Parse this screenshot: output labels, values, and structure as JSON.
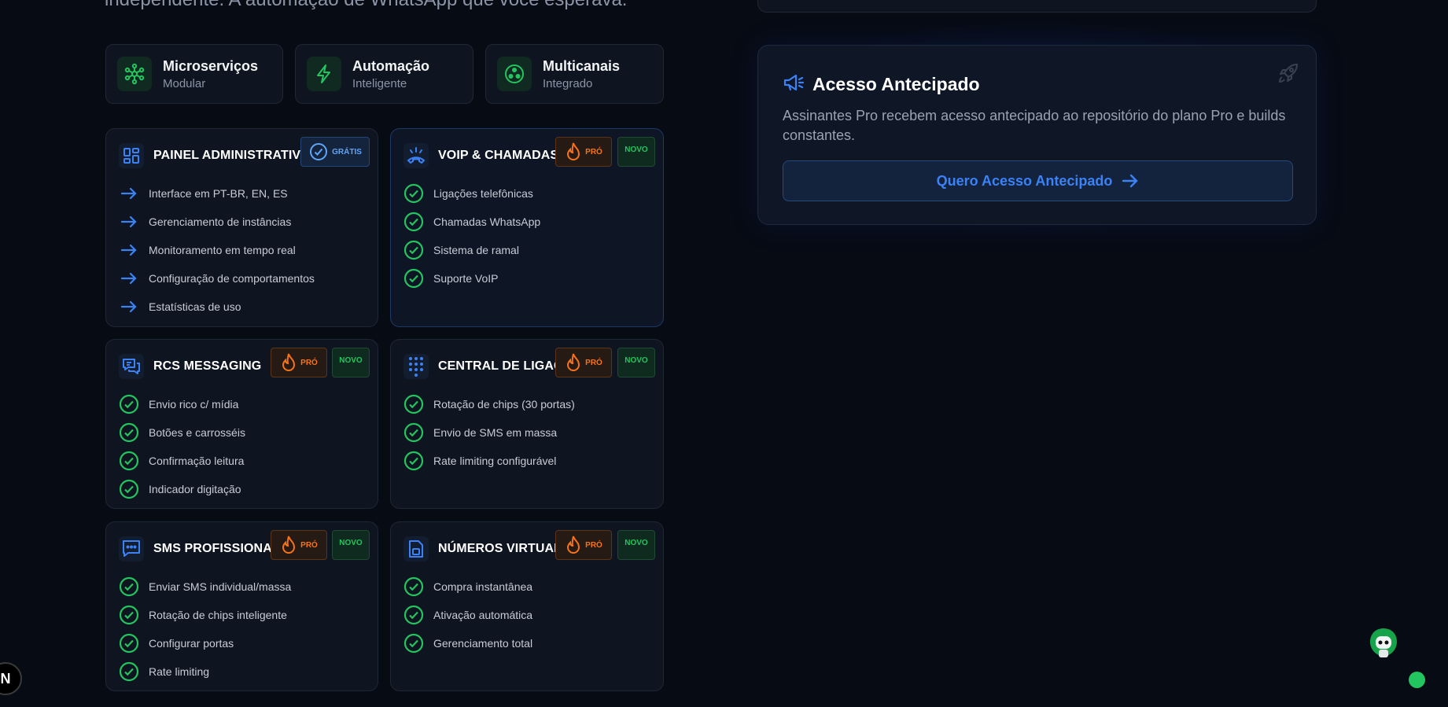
{
  "hero": {
    "subtitle": "independente. A automação de WhatsApp que você esperava."
  },
  "pills": [
    {
      "title": "Microserviços",
      "subtitle": "Modular",
      "icon": "network-icon"
    },
    {
      "title": "Automação",
      "subtitle": "Inteligente",
      "icon": "lightning-icon"
    },
    {
      "title": "Multicanais",
      "subtitle": "Integrado",
      "icon": "channels-icon"
    }
  ],
  "cards": {
    "admin": {
      "title": "PAINEL ADMINISTRATIVO",
      "badge": "GRÁTIS",
      "items": [
        "Interface em PT-BR, EN, ES",
        "Gerenciamento de instâncias",
        "Monitoramento em tempo real",
        "Configuração de comportamentos",
        "Estatísticas de uso"
      ]
    },
    "voip": {
      "title": "VOIP & CHAMADAS",
      "pro": "PRÓ",
      "novo": "NOVO",
      "items": [
        "Ligações telefônicas",
        "Chamadas WhatsApp",
        "Sistema de ramal",
        "Suporte VoIP"
      ]
    },
    "rcs": {
      "title": "RCS MESSAGING",
      "pro": "PRÓ",
      "novo": "NOVO",
      "items": [
        "Envio rico c/ mídia",
        "Botões e carrosséis",
        "Confirmação leitura",
        "Indicador digitação"
      ]
    },
    "central": {
      "title": "CENTRAL DE LIGAÇÕES",
      "pro": "PRÓ",
      "novo": "NOVO",
      "items": [
        "Rotação de chips (30 portas)",
        "Envio de SMS em massa",
        "Rate limiting configurável"
      ]
    },
    "sms": {
      "title": "SMS PROFISSIONAL",
      "pro": "PRÓ",
      "novo": "NOVO",
      "items": [
        "Enviar SMS individual/massa",
        "Rotação de chips inteligente",
        "Configurar portas",
        "Rate limiting"
      ]
    },
    "numeros": {
      "title": "NÚMEROS VIRTUAIS",
      "pro": "PRÓ",
      "novo": "NOVO",
      "items": [
        "Compra instantânea",
        "Ativação automática",
        "Gerenciamento total"
      ]
    }
  },
  "early_access": {
    "title": "Acesso Antecipado",
    "description": "Assinantes Pro recebem acesso antecipado ao repositório do plano Pro e builds constantes.",
    "button": "Quero Acesso Antecipado"
  },
  "misc": {
    "n_badge": "N"
  },
  "colors": {
    "background": "#070b14",
    "accent_blue": "#3b82f6",
    "accent_green": "#22c55e",
    "accent_orange": "#f97316"
  }
}
